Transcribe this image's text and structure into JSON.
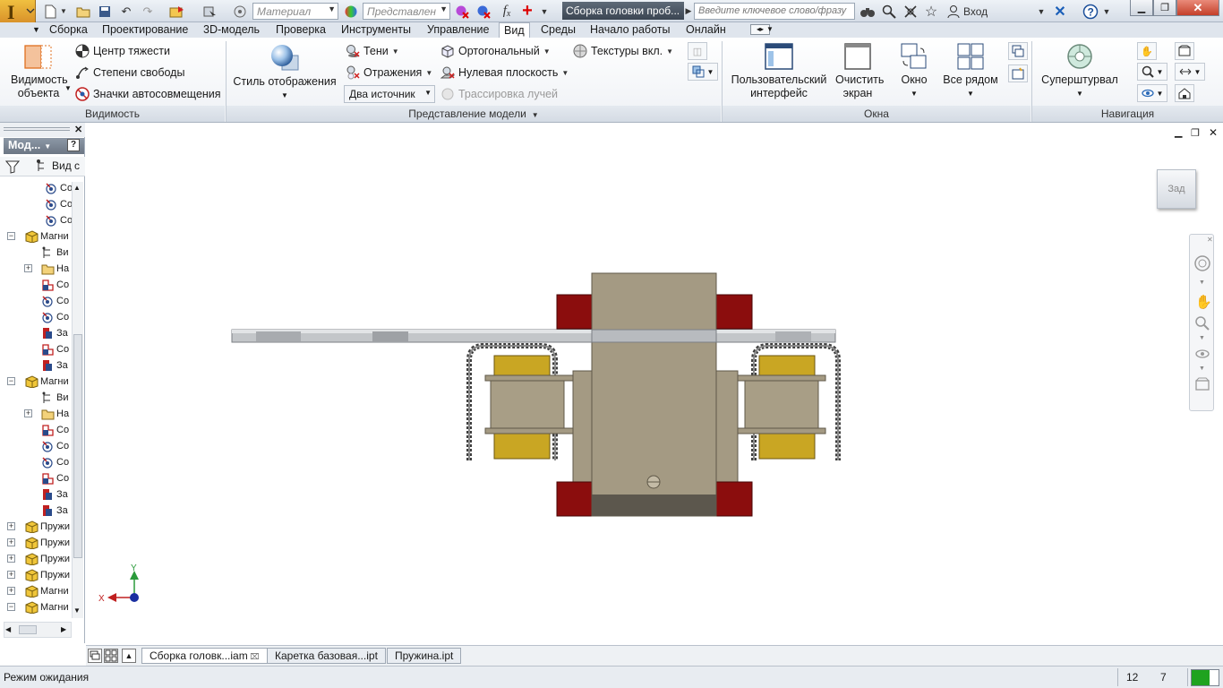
{
  "titlebar": {
    "material_placeholder": "Материал",
    "representation_placeholder": "Представлен",
    "fx_label": "f",
    "fx_sub": "x",
    "document_title": "Сборка головки проб...",
    "search_placeholder": "Введите ключевое слово/фразу",
    "signin_label": "Вход"
  },
  "menu": {
    "tabs": [
      "Сборка",
      "Проектирование",
      "3D-модель",
      "Проверка",
      "Инструменты",
      "Управление",
      "Вид",
      "Среды",
      "Начало работы",
      "Онлайн"
    ],
    "active_index": 6
  },
  "ribbon": {
    "visibility": {
      "title": "Видимость",
      "object_visibility": "Видимость объекта",
      "center_of_gravity": "Центр тяжести",
      "degrees_of_freedom": "Степени свободы",
      "auto_constraint_icons": "Значки автосовмещения"
    },
    "model_display": {
      "title": "Представление модели",
      "visual_style": "Стиль отображения",
      "shadows": "Тени",
      "reflections": "Отражения",
      "lights_value": "Два источник",
      "orthographic": "Ортогональный",
      "ground_plane": "Нулевая плоскость",
      "ray_tracing": "Трассировка лучей",
      "textures_on": "Текстуры вкл."
    },
    "windows": {
      "title": "Окна",
      "user_interface": "Пользовательский интерфейс",
      "clean_screen": "Очистить экран",
      "window": "Окно",
      "tile_all": "Все рядом"
    },
    "navigate": {
      "title": "Навигация",
      "steering_wheel": "Суперштурвал"
    }
  },
  "browser": {
    "header": "Мод...",
    "view_label": "Вид с",
    "rows": [
      {
        "label": "Со",
        "icon": "constraint",
        "level": 2
      },
      {
        "label": "Со",
        "icon": "constraint",
        "level": 2
      },
      {
        "label": "Со",
        "icon": "constraint",
        "level": 2
      },
      {
        "label": "Магни",
        "icon": "assembly",
        "level": 0,
        "exp": "−"
      },
      {
        "label": "Ви",
        "icon": "view",
        "level": 1
      },
      {
        "label": "На",
        "icon": "folder",
        "level": 1,
        "exp": "+"
      },
      {
        "label": "Со",
        "icon": "part",
        "level": 1
      },
      {
        "label": "Со",
        "icon": "constraint",
        "level": 1
      },
      {
        "label": "Со",
        "icon": "constraint",
        "level": 1
      },
      {
        "label": "За",
        "icon": "part2",
        "level": 1
      },
      {
        "label": "Со",
        "icon": "part",
        "level": 1
      },
      {
        "label": "За",
        "icon": "part2",
        "level": 1
      },
      {
        "label": "Магни",
        "icon": "assembly",
        "level": 0,
        "exp": "−"
      },
      {
        "label": "Ви",
        "icon": "view",
        "level": 1
      },
      {
        "label": "На",
        "icon": "folder",
        "level": 1,
        "exp": "+"
      },
      {
        "label": "Со",
        "icon": "part",
        "level": 1
      },
      {
        "label": "Со",
        "icon": "constraint",
        "level": 1
      },
      {
        "label": "Со",
        "icon": "constraint",
        "level": 1
      },
      {
        "label": "Со",
        "icon": "part",
        "level": 1
      },
      {
        "label": "За",
        "icon": "part2",
        "level": 1
      },
      {
        "label": "За",
        "icon": "part2",
        "level": 1
      },
      {
        "label": "Пружи",
        "icon": "assembly",
        "level": 0,
        "exp": "+"
      },
      {
        "label": "Пружи",
        "icon": "assembly",
        "level": 0,
        "exp": "+"
      },
      {
        "label": "Пружи",
        "icon": "assembly",
        "level": 0,
        "exp": "+"
      },
      {
        "label": "Пружи",
        "icon": "assembly",
        "level": 0,
        "exp": "+"
      },
      {
        "label": "Магни",
        "icon": "assembly",
        "level": 0,
        "exp": "+"
      },
      {
        "label": "Магни",
        "icon": "assembly",
        "level": 0,
        "exp": "−"
      }
    ]
  },
  "viewport": {
    "viewcube_label": "Зад",
    "axis_x": "X",
    "axis_y": "Y"
  },
  "doc_tabs": [
    {
      "label": "Сборка головк...iam",
      "active": true
    },
    {
      "label": "Каретка базовая...ipt",
      "active": false
    },
    {
      "label": "Пружина.ipt",
      "active": false
    }
  ],
  "status": {
    "text": "Режим ожидания",
    "count1": "12",
    "count2": "7"
  },
  "colors": {
    "active_tab": "#ffffff",
    "panel_title_bg": "#d8dee6",
    "model_body": "#a49a83",
    "model_red": "#8b0d0d",
    "model_yellow": "#c9a623",
    "status_green": "#1fa31f"
  }
}
